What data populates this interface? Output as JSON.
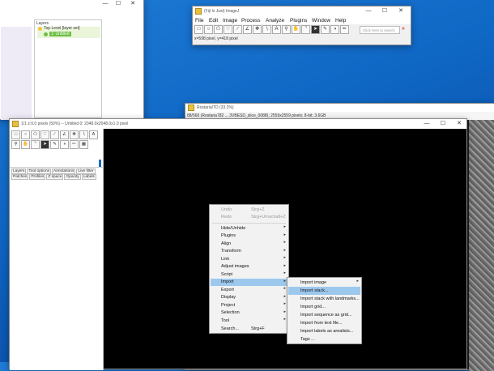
{
  "left_window": {
    "layers_header": "Layers",
    "layer_items": [
      "Top Level [layer set]",
      "1: Untitled"
    ]
  },
  "imagej": {
    "title": "(Fiji Is Just) ImageJ",
    "menus": [
      "File",
      "Edit",
      "Image",
      "Process",
      "Analyze",
      "Plugins",
      "Window",
      "Help"
    ],
    "search_placeholder": "Click here to search",
    "status": "x=598 pixel, y=418 pixel"
  },
  "image_window": {
    "title": "Rostaria/TD (33.3%)",
    "info": "88/560 (Rostaria782 ... 3VBESD_slice_0088); 2559x2559 pixels; 8-bit; 3.6GB"
  },
  "canvas_window": {
    "title": "1/1 z:0.0 pixels (50%) -- Untitled 0: 2048.0x2048.0x1.0 pixel",
    "tabs_row1": [
      "Layers",
      "Tool options",
      "Annotations",
      "Live filter"
    ],
    "tabs_row2": [
      "Patches",
      "Profiles",
      "Z space",
      "Opacity",
      "Labels"
    ]
  },
  "context_menu": {
    "items": [
      {
        "label": "Undo",
        "shortcut": "Strg+Z",
        "disabled": true
      },
      {
        "label": "Redo",
        "shortcut": "Strg+Umschalt+Z",
        "disabled": true
      },
      {
        "label": "Hide/Unhide",
        "submenu": true
      },
      {
        "label": "Plugins",
        "submenu": true
      },
      {
        "label": "Align",
        "submenu": true
      },
      {
        "label": "Transform",
        "submenu": true
      },
      {
        "label": "Link",
        "submenu": true
      },
      {
        "label": "Adjust images",
        "submenu": true
      },
      {
        "label": "Script",
        "submenu": true
      },
      {
        "label": "Import",
        "submenu": true,
        "highlighted": true
      },
      {
        "label": "Export",
        "submenu": true
      },
      {
        "label": "Display",
        "submenu": true
      },
      {
        "label": "Project",
        "submenu": true
      },
      {
        "label": "Selection",
        "submenu": true
      },
      {
        "label": "Tool",
        "submenu": true
      },
      {
        "label": "Search...",
        "shortcut": "Strg+F"
      }
    ]
  },
  "import_submenu": {
    "items": [
      {
        "label": "Import image",
        "submenu": true
      },
      {
        "label": "Import stack...",
        "highlighted": true
      },
      {
        "label": "Import stack with landmarks..."
      },
      {
        "label": "Import grid..."
      },
      {
        "label": "Import sequence as grid..."
      },
      {
        "label": "Import from text file..."
      },
      {
        "label": "Import labels as arealists..."
      },
      {
        "label": "Tags ..."
      }
    ]
  },
  "colors": {
    "desktop": "#0f67c4",
    "menu_highlight": "#9dc8ee",
    "layer_selected": "#6cbf43"
  }
}
